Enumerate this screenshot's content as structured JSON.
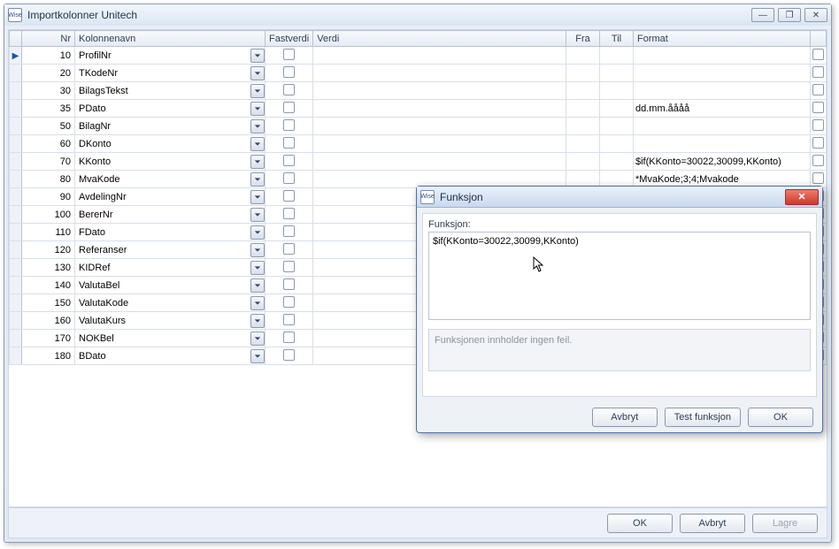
{
  "window": {
    "title": "Importkolonner Unitech",
    "app_icon_text": "Wise"
  },
  "columns": {
    "nr": "Nr",
    "name": "Kolonnenavn",
    "fast": "Fastverdi",
    "verdi": "Verdi",
    "fra": "Fra",
    "til": "Til",
    "format": "Format"
  },
  "rows": [
    {
      "nr": "10",
      "name": "ProfilNr",
      "format": ""
    },
    {
      "nr": "20",
      "name": "TKodeNr",
      "format": ""
    },
    {
      "nr": "30",
      "name": "BilagsTekst",
      "format": ""
    },
    {
      "nr": "35",
      "name": "PDato",
      "format": "dd.mm.åååå"
    },
    {
      "nr": "50",
      "name": "BilagNr",
      "format": ""
    },
    {
      "nr": "60",
      "name": "DKonto",
      "format": ""
    },
    {
      "nr": "70",
      "name": "KKonto",
      "format": "$if(KKonto=30022,30099,KKonto)"
    },
    {
      "nr": "80",
      "name": "MvaKode",
      "format": "*MvaKode;3;4;Mvakode"
    },
    {
      "nr": "90",
      "name": "AvdelingNr",
      "format": ""
    },
    {
      "nr": "100",
      "name": "BererNr",
      "format": ""
    },
    {
      "nr": "110",
      "name": "FDato",
      "format": ""
    },
    {
      "nr": "120",
      "name": "Referanser",
      "format": ""
    },
    {
      "nr": "130",
      "name": "KIDRef",
      "format": ""
    },
    {
      "nr": "140",
      "name": "ValutaBel",
      "format": ""
    },
    {
      "nr": "150",
      "name": "ValutaKode",
      "format": ""
    },
    {
      "nr": "160",
      "name": "ValutaKurs",
      "format": ""
    },
    {
      "nr": "170",
      "name": "NOKBel",
      "format": ""
    },
    {
      "nr": "180",
      "name": "BDato",
      "format": ""
    }
  ],
  "footer": {
    "ok": "OK",
    "cancel": "Avbryt",
    "save": "Lagre"
  },
  "dialog": {
    "title": "Funksjon",
    "app_icon_text": "Wise",
    "label": "Funksjon:",
    "value": "$if(KKonto=30022,30099,KKonto)",
    "status": "Funksjonen innholder ingen feil.",
    "cancel": "Avbryt",
    "test": "Test funksjon",
    "ok": "OK"
  }
}
